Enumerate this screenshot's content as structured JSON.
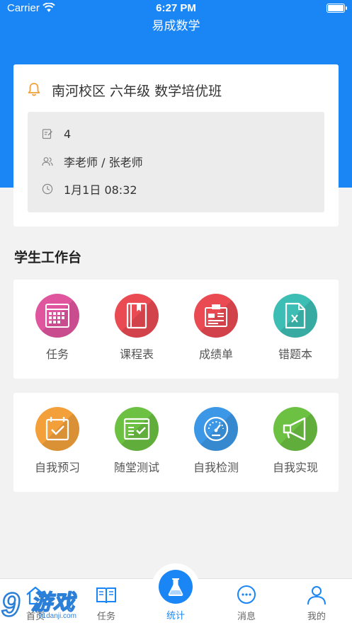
{
  "status_bar": {
    "carrier": "Carrier",
    "time": "6:27 PM"
  },
  "header": {
    "title": "易成数学"
  },
  "class_card": {
    "class_name": "南河校区 六年级 数学培优班",
    "lessons": "4",
    "teachers": "李老师 / 张老师",
    "time": "1月1日 08:32"
  },
  "workbench": {
    "title": "学生工作台",
    "row1": [
      {
        "label": "任务",
        "icon": "calendar-grid-icon",
        "color": "#e0569e"
      },
      {
        "label": "课程表",
        "icon": "book-icon",
        "color": "#ea4a52"
      },
      {
        "label": "成绩单",
        "icon": "report-clipboard-icon",
        "color": "#ea4a52"
      },
      {
        "label": "错题本",
        "icon": "x-document-icon",
        "color": "#3dbeb4"
      }
    ],
    "row2": [
      {
        "label": "自我预习",
        "icon": "calendar-check-icon",
        "color": "#f3a03a"
      },
      {
        "label": "随堂测试",
        "icon": "checklist-icon",
        "color": "#6cc143"
      },
      {
        "label": "自我检测",
        "icon": "speedometer-icon",
        "color": "#3c97e6"
      },
      {
        "label": "自我实现",
        "icon": "megaphone-icon",
        "color": "#6cc143"
      }
    ]
  },
  "tab_bar": {
    "home": "首页",
    "tasks": "任务",
    "stats": "统计",
    "messages": "消息",
    "mine": "我的"
  },
  "watermark": {
    "text": "游戏",
    "site": "91danji.com",
    "prefix": "9"
  }
}
